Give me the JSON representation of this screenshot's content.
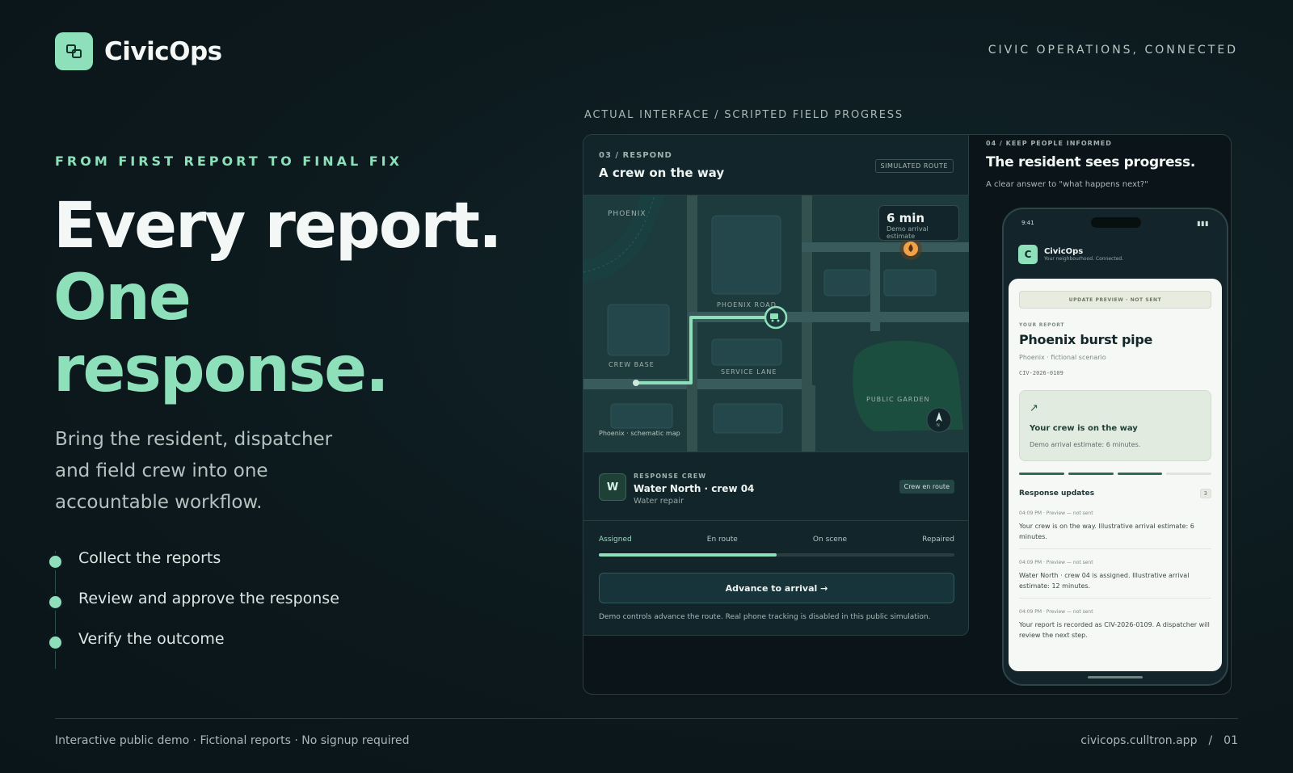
{
  "brand": {
    "name": "CivicOps",
    "tagline": "CIVIC OPERATIONS, CONNECTED",
    "icon": "civic-logo-icon",
    "accent": "#8ee0bb"
  },
  "hero": {
    "eyebrow": "FROM FIRST REPORT TO FINAL FIX",
    "line1": "Every report.",
    "line2": "One",
    "line3": "response.",
    "lede": "Bring the resident, dispatcher and field crew into one accountable workflow.",
    "steps": [
      "Collect the reports",
      "Review and approve the response",
      "Verify the outcome"
    ]
  },
  "mockup": {
    "caption": "ACTUAL INTERFACE / SCRIPTED FIELD PROGRESS",
    "respond": {
      "kicker": "03 / RESPOND",
      "title": "A crew on the way",
      "badge": "SIMULATED ROUTE",
      "map": {
        "labels": {
          "phoenix": "PHOENIX",
          "phoenix_road": "PHOENIX ROAD",
          "crew_base": "CREW BASE",
          "service_lane": "SERVICE LANE",
          "public_garden": "PUBLIC GARDEN",
          "north": "N"
        },
        "eta_value": "6 min",
        "eta_sub": "Demo arrival estimate",
        "caption": "Phoenix · schematic map"
      },
      "crew": {
        "initial": "W",
        "kicker": "RESPONSE CREW",
        "name": "Water North · crew 04",
        "specialty": "Water repair",
        "status": "Crew en route"
      },
      "progress": {
        "steps": [
          "Assigned",
          "En route",
          "On scene",
          "Repaired"
        ],
        "fraction": 0.5
      },
      "advance_label": "Advance to arrival →",
      "note": "Demo controls advance the route. Real phone tracking is disabled in this public simulation."
    },
    "inform": {
      "kicker": "04 / KEEP PEOPLE INFORMED",
      "title": "The resident sees progress.",
      "subtitle": "A clear answer to \"what happens next?\"",
      "phone": {
        "time": "9:41",
        "battery": "▮▮▮",
        "app_initial": "C",
        "app_name": "CivicOps",
        "app_sub": "Your neighbourhood. Connected.",
        "banner": "UPDATE PREVIEW · NOT SENT",
        "report_kicker": "YOUR REPORT",
        "report_title": "Phoenix burst pipe",
        "report_location": "Phoenix · fictional scenario",
        "report_id": "CIV-2026-0109",
        "status_title": "Your crew is on the way",
        "status_eta": "Demo arrival estimate: 6 minutes.",
        "updates_title": "Response updates",
        "updates_count": "3",
        "updates": [
          {
            "meta": "04:09 PM · Preview — not sent",
            "body": "Your crew is on the way. Illustrative arrival estimate: 6 minutes."
          },
          {
            "meta": "04:09 PM · Preview — not sent",
            "body": "Water North · crew 04 is assigned. Illustrative arrival estimate: 12 minutes."
          },
          {
            "meta": "04:09 PM · Preview — not sent",
            "body": "Your report is recorded as CIV-2026-0109. A dispatcher will review the next step."
          }
        ]
      }
    }
  },
  "footer": {
    "left": "Interactive public demo · Fictional reports · No signup required",
    "url": "civicops.culltron.app",
    "sep": "/",
    "page": "01"
  }
}
